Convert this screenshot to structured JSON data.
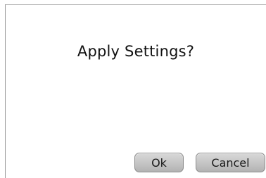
{
  "dialog": {
    "message": "Apply Settings?",
    "ok_label": "Ok",
    "cancel_label": "Cancel"
  }
}
